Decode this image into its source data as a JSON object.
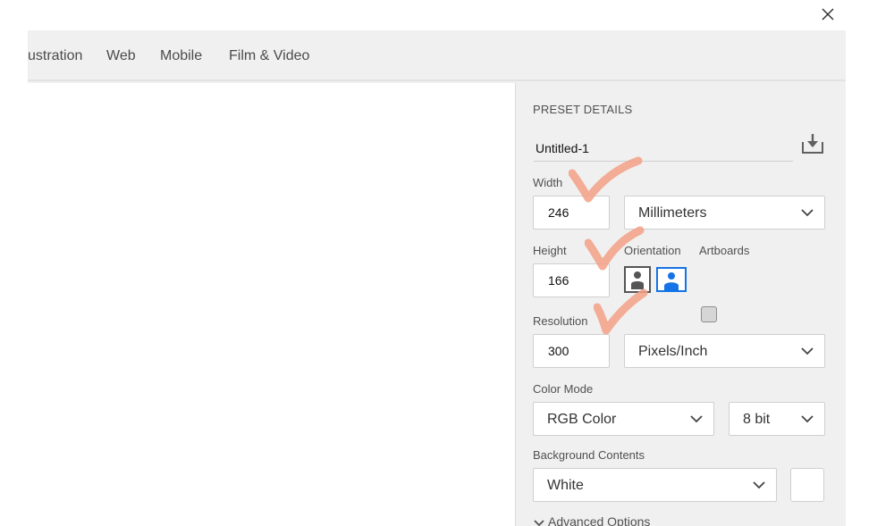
{
  "window": {
    "close_icon": "close-icon"
  },
  "tabs": [
    {
      "label": "ustration"
    },
    {
      "label": "Web"
    },
    {
      "label": "Mobile"
    },
    {
      "label": "Film & Video"
    }
  ],
  "preset": {
    "title": "PRESET DETAILS",
    "name": "Untitled-1",
    "save_icon": "save-preset-icon",
    "width": {
      "label": "Width",
      "value": "246",
      "unit": "Millimeters"
    },
    "height": {
      "label": "Height",
      "value": "166"
    },
    "orientation": {
      "label": "Orientation",
      "selected": "landscape"
    },
    "artboards": {
      "label": "Artboards",
      "checked": false
    },
    "resolution": {
      "label": "Resolution",
      "value": "300",
      "unit": "Pixels/Inch"
    },
    "color_mode": {
      "label": "Color Mode",
      "mode": "RGB Color",
      "depth": "8 bit"
    },
    "background": {
      "label": "Background Contents",
      "value": "White",
      "swatch_color": "#ffffff"
    },
    "advanced_label": "Advanced Options"
  },
  "colors": {
    "accent": "#1473e6",
    "annotation_check": "#f3a085",
    "panel_bg": "#f0f0f0"
  }
}
